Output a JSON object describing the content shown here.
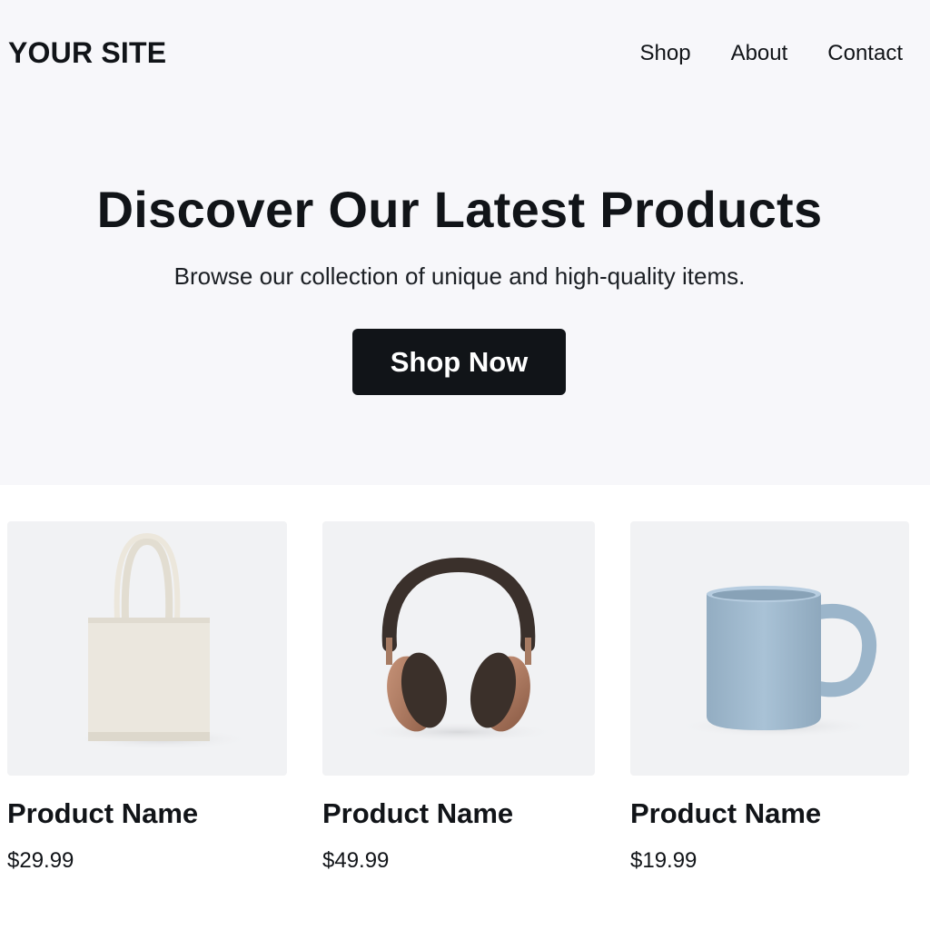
{
  "header": {
    "logo": "YOUR SITE",
    "nav": [
      "Shop",
      "About",
      "Contact"
    ]
  },
  "hero": {
    "title": "Discover Our Latest Products",
    "subtitle": "Browse our collection of unique and high-quality items.",
    "cta_label": "Shop Now"
  },
  "products": [
    {
      "name": "Product Name",
      "price": "$29.99",
      "image": "tote-bag-image"
    },
    {
      "name": "Product Name",
      "price": "$49.99",
      "image": "headphones-image"
    },
    {
      "name": "Product Name",
      "price": "$19.99",
      "image": "mug-image"
    }
  ],
  "colors": {
    "hero_background": "#f7f7fa",
    "button_background": "#111418",
    "card_background": "#f1f2f4",
    "text": "#111418"
  }
}
